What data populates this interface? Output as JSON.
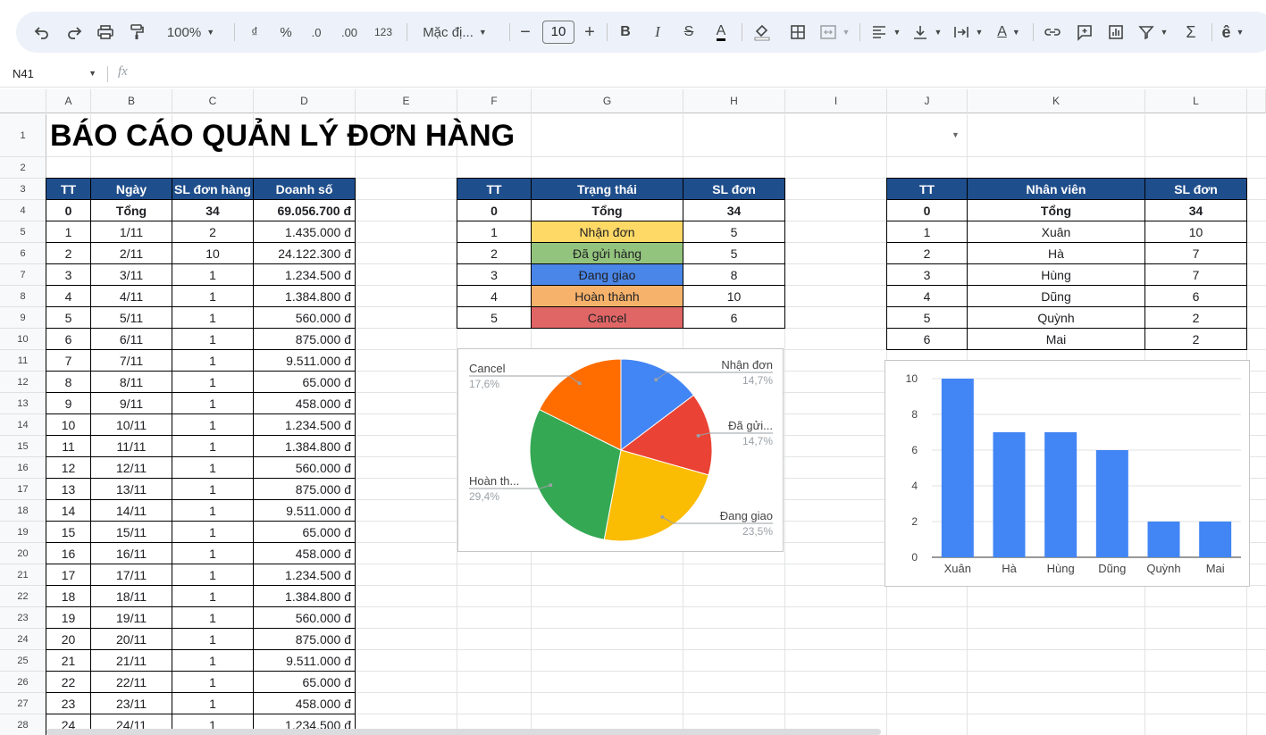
{
  "toolbar": {
    "zoom": "100%",
    "currency": "₫",
    "percent": "%",
    "dec_down": ".0",
    "dec_up": ".00",
    "num_format": "123",
    "font": "Mặc đị...",
    "font_size": "10"
  },
  "formula_bar": {
    "name_box": "N41",
    "fx": "fx"
  },
  "columns": [
    {
      "l": "A",
      "w": 50
    },
    {
      "l": "B",
      "w": 91
    },
    {
      "l": "C",
      "w": 91
    },
    {
      "l": "D",
      "w": 114
    },
    {
      "l": "E",
      "w": 114
    },
    {
      "l": "F",
      "w": 83
    },
    {
      "l": "G",
      "w": 170
    },
    {
      "l": "H",
      "w": 114
    },
    {
      "l": "I",
      "w": 114
    },
    {
      "l": "J",
      "w": 90
    },
    {
      "l": "K",
      "w": 199
    },
    {
      "l": "L",
      "w": 114
    }
  ],
  "rows": [
    "1",
    "2",
    "3",
    "4",
    "5",
    "6",
    "7",
    "8",
    "9",
    "10",
    "11",
    "12",
    "13",
    "14",
    "15",
    "16",
    "17",
    "18",
    "19",
    "20",
    "21",
    "22",
    "23",
    "24",
    "25",
    "26",
    "27",
    "28"
  ],
  "title": "BÁO CÁO QUẢN LÝ ĐƠN HÀNG",
  "colors": {
    "header_bg": "#1f4e8c",
    "pie": [
      "#4285f4",
      "#ea4335",
      "#fbbc04",
      "#34a853",
      "#ff6d01"
    ],
    "bar": "#4285f4"
  },
  "daily": {
    "headers": [
      "TT",
      "Ngày",
      "SL đơn hàng",
      "Doanh số"
    ],
    "total": [
      "0",
      "Tổng",
      "34",
      "69.056.700 đ"
    ],
    "rows": [
      [
        "1",
        "1/11",
        "2",
        "1.435.000 đ"
      ],
      [
        "2",
        "2/11",
        "10",
        "24.122.300 đ"
      ],
      [
        "3",
        "3/11",
        "1",
        "1.234.500 đ"
      ],
      [
        "4",
        "4/11",
        "1",
        "1.384.800 đ"
      ],
      [
        "5",
        "5/11",
        "1",
        "560.000 đ"
      ],
      [
        "6",
        "6/11",
        "1",
        "875.000 đ"
      ],
      [
        "7",
        "7/11",
        "1",
        "9.511.000 đ"
      ],
      [
        "8",
        "8/11",
        "1",
        "65.000 đ"
      ],
      [
        "9",
        "9/11",
        "1",
        "458.000 đ"
      ],
      [
        "10",
        "10/11",
        "1",
        "1.234.500 đ"
      ],
      [
        "11",
        "11/11",
        "1",
        "1.384.800 đ"
      ],
      [
        "12",
        "12/11",
        "1",
        "560.000 đ"
      ],
      [
        "13",
        "13/11",
        "1",
        "875.000 đ"
      ],
      [
        "14",
        "14/11",
        "1",
        "9.511.000 đ"
      ],
      [
        "15",
        "15/11",
        "1",
        "65.000 đ"
      ],
      [
        "16",
        "16/11",
        "1",
        "458.000 đ"
      ],
      [
        "17",
        "17/11",
        "1",
        "1.234.500 đ"
      ],
      [
        "18",
        "18/11",
        "1",
        "1.384.800 đ"
      ],
      [
        "19",
        "19/11",
        "1",
        "560.000 đ"
      ],
      [
        "20",
        "20/11",
        "1",
        "875.000 đ"
      ],
      [
        "21",
        "21/11",
        "1",
        "9.511.000 đ"
      ],
      [
        "22",
        "22/11",
        "1",
        "65.000 đ"
      ],
      [
        "23",
        "23/11",
        "1",
        "458.000 đ"
      ],
      [
        "24",
        "24/11",
        "1",
        "1.234.500 đ"
      ]
    ]
  },
  "status": {
    "headers": [
      "TT",
      "Trạng thái",
      "SL đơn"
    ],
    "total": [
      "0",
      "Tổng",
      "34"
    ],
    "rows": [
      {
        "tt": "1",
        "name": "Nhận đơn",
        "count": "5",
        "color": "#ffd966"
      },
      {
        "tt": "2",
        "name": "Đã gửi hàng",
        "count": "5",
        "color": "#93c47d"
      },
      {
        "tt": "3",
        "name": "Đang giao",
        "count": "8",
        "color": "#4a86e8"
      },
      {
        "tt": "4",
        "name": "Hoàn thành",
        "count": "10",
        "color": "#f6b26b"
      },
      {
        "tt": "5",
        "name": "Cancel",
        "count": "6",
        "color": "#e06666"
      }
    ]
  },
  "staff": {
    "headers": [
      "TT",
      "Nhân viên",
      "SL đơn"
    ],
    "total": [
      "0",
      "Tổng",
      "34"
    ],
    "rows": [
      [
        "1",
        "Xuân",
        "10"
      ],
      [
        "2",
        "Hà",
        "7"
      ],
      [
        "3",
        "Hùng",
        "7"
      ],
      [
        "4",
        "Dũng",
        "6"
      ],
      [
        "5",
        "Quỳnh",
        "2"
      ],
      [
        "6",
        "Mai",
        "2"
      ]
    ]
  },
  "chart_data": [
    {
      "type": "pie",
      "title": "",
      "slices": [
        {
          "label": "Nhận đơn",
          "value": 5,
          "pct": "14,7%"
        },
        {
          "label": "Đã gửi...",
          "value": 5,
          "pct": "14,7%"
        },
        {
          "label": "Đang giao",
          "value": 8,
          "pct": "23,5%"
        },
        {
          "label": "Hoàn th...",
          "value": 10,
          "pct": "29,4%"
        },
        {
          "label": "Cancel",
          "value": 6,
          "pct": "17,6%"
        }
      ]
    },
    {
      "type": "bar",
      "title": "",
      "categories": [
        "Xuân",
        "Hà",
        "Hùng",
        "Dũng",
        "Quỳnh",
        "Mai"
      ],
      "values": [
        10,
        7,
        7,
        6,
        2,
        2
      ],
      "ylim": [
        0,
        10
      ],
      "yticks": [
        "0",
        "2",
        "4",
        "6",
        "8",
        "10"
      ]
    }
  ]
}
